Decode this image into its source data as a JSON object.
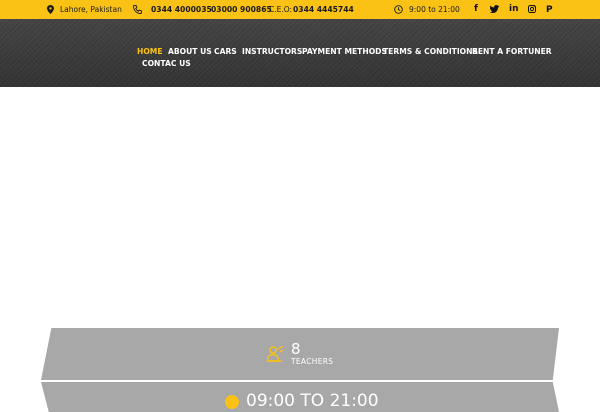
{
  "topbar": {
    "location": "Lahore, Pakistan",
    "phone1": "0344 4000035",
    "phone2": "03000 900865",
    "ceo_label": "C.E.O:",
    "ceo_phone": "0344 4445744",
    "hours": "9:00 to 21:00",
    "social": [
      {
        "icon": "facebook-icon",
        "glyph": "f"
      },
      {
        "icon": "twitter-icon",
        "glyph": "t"
      },
      {
        "icon": "linkedin-icon",
        "glyph": "in"
      },
      {
        "icon": "instagram-icon",
        "glyph": ""
      },
      {
        "icon": "pinterest-icon",
        "glyph": "P"
      }
    ]
  },
  "nav": {
    "items": [
      {
        "label": "HOME",
        "active": true
      },
      {
        "label": "ABOUT US"
      },
      {
        "label": "CARS"
      },
      {
        "label": "INSTRUCTORS"
      },
      {
        "label": "PAYMENT METHODS"
      },
      {
        "label": "TERMS & CONDITIONS"
      },
      {
        "label": "RENT A FORTUNER"
      },
      {
        "label": "CONTAC US"
      }
    ]
  },
  "stats": {
    "teachers_count": "8",
    "teachers_label": "TEACHERS",
    "hours": "09:00 TO 21:00"
  },
  "colors": {
    "accent": "#f9c214",
    "header_bg": "#3a3a3a",
    "band": "#a8a8a8"
  }
}
